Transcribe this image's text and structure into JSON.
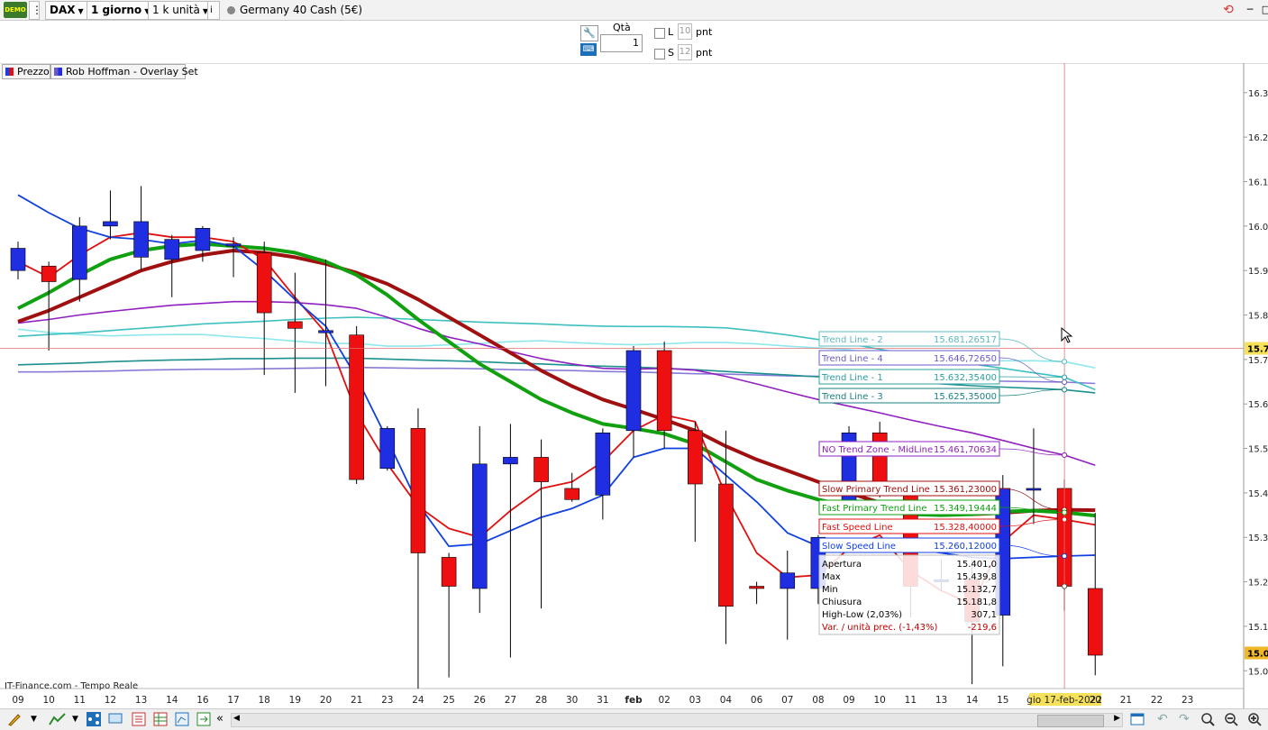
{
  "toolbar": {
    "logo": "DEMO",
    "instrument": "DAX",
    "timeframe": "1 giorno",
    "units": "1 k unità",
    "info_icon": "i",
    "market": "Germany 40 Cash (5€)"
  },
  "order": {
    "qty_label": "Qtà",
    "qty_value": "1",
    "long_label": "L",
    "long_points": "10",
    "short_label": "S",
    "short_points": "12",
    "points_unit": "pnt"
  },
  "legend_tabs": [
    "Prezzo",
    "Rob Hoffman - Overlay Set"
  ],
  "watermark": "IT-Finance.com - Tempo Reale",
  "chart_data": {
    "type": "candlestick",
    "price_axis": {
      "ymin": 14960,
      "ymax": 16330,
      "ticks": [
        15000,
        15100,
        15200,
        15300,
        15400,
        15500,
        15600,
        15700,
        15800,
        15900,
        16000,
        16100,
        16200,
        16300
      ],
      "tick_labels": [
        "15.0",
        "15.1",
        "15.2",
        "15.3",
        "15.4",
        "15.5",
        "15.6",
        "15.7",
        "15.8",
        "15.9",
        "16.0",
        "16.1",
        "16.2",
        "16.3"
      ],
      "current_label": "15.7",
      "current_price": 15725,
      "last_close_label": "15.0",
      "last_close_price": 15040
    },
    "date_labels": [
      "09",
      "10",
      "11",
      "12",
      "13",
      "14",
      "16",
      "17",
      "18",
      "19",
      "20",
      "21",
      "23",
      "24",
      "25",
      "26",
      "27",
      "28",
      "30",
      "31",
      "feb",
      "02",
      "03",
      "04",
      "06",
      "07",
      "08",
      "09",
      "10",
      "11",
      "13",
      "14",
      "15",
      "16",
      "gio 17-feb-2022",
      "20",
      "21",
      "22",
      "23"
    ],
    "highlighted_date": "gio 17-feb-2022",
    "candles": [
      {
        "o": 15900,
        "c": 15950,
        "h": 15965,
        "l": 15880
      },
      {
        "o": 15910,
        "c": 15875,
        "h": 15920,
        "l": 15720
      },
      {
        "o": 15880,
        "c": 16000,
        "h": 16020,
        "l": 15830
      },
      {
        "o": 16000,
        "c": 16010,
        "h": 16080,
        "l": 15970
      },
      {
        "o": 15930,
        "c": 16010,
        "h": 16090,
        "l": 15900
      },
      {
        "o": 15925,
        "c": 15970,
        "h": 15980,
        "l": 15840
      },
      {
        "o": 15945,
        "c": 15995,
        "h": 16000,
        "l": 15920
      },
      {
        "o": 15955,
        "c": 15960,
        "h": 15975,
        "l": 15885
      },
      {
        "o": 15940,
        "c": 15805,
        "h": 15965,
        "l": 15665
      },
      {
        "o": 15785,
        "c": 15770,
        "h": 15895,
        "l": 15625
      },
      {
        "o": 15760,
        "c": 15765,
        "h": 15925,
        "l": 15640
      },
      {
        "o": 15755,
        "c": 15430,
        "h": 15775,
        "l": 15420
      },
      {
        "o": 15455,
        "c": 15545,
        "h": 15550,
        "l": 15450
      },
      {
        "o": 15545,
        "c": 15265,
        "h": 15590,
        "l": 14960
      },
      {
        "o": 15255,
        "c": 15190,
        "h": 15265,
        "l": 14985
      },
      {
        "o": 15185,
        "c": 15465,
        "h": 15550,
        "l": 15130
      },
      {
        "o": 15465,
        "c": 15480,
        "h": 15555,
        "l": 15030
      },
      {
        "o": 15480,
        "c": 15425,
        "h": 15520,
        "l": 15140
      },
      {
        "o": 15410,
        "c": 15385,
        "h": 15445,
        "l": 15380
      },
      {
        "o": 15395,
        "c": 15535,
        "h": 15545,
        "l": 15340
      },
      {
        "o": 15540,
        "c": 15720,
        "h": 15730,
        "l": 15480
      },
      {
        "o": 15720,
        "c": 15540,
        "h": 15740,
        "l": 15500
      },
      {
        "o": 15540,
        "c": 15420,
        "h": 15560,
        "l": 15290
      },
      {
        "o": 15420,
        "c": 15145,
        "h": 15540,
        "l": 15060
      },
      {
        "o": 15190,
        "c": 15185,
        "h": 15200,
        "l": 15150
      },
      {
        "o": 15185,
        "c": 15220,
        "h": 15270,
        "l": 15070
      },
      {
        "o": 15185,
        "c": 15300,
        "h": 15305,
        "l": 15150
      },
      {
        "o": 15380,
        "c": 15535,
        "h": 15550,
        "l": 15370
      },
      {
        "o": 15535,
        "c": 15400,
        "h": 15560,
        "l": 15390
      },
      {
        "o": 15400,
        "c": 15190,
        "h": 15420,
        "l": 15120
      },
      {
        "o": 15200,
        "c": 15205,
        "h": 15250,
        "l": 15180
      },
      {
        "o": 15205,
        "c": 15110,
        "h": 15250,
        "l": 14970
      },
      {
        "o": 15125,
        "c": 15410,
        "h": 15440,
        "l": 15010
      },
      {
        "o": 15410,
        "c": 15410,
        "h": 15545,
        "l": 15330
      },
      {
        "o": 15410,
        "c": 15190,
        "h": 15430,
        "l": 15135
      },
      {
        "o": 15185,
        "c": 15035,
        "h": 15355,
        "l": 14990
      }
    ],
    "series": [
      {
        "name": "Trend Line - 2",
        "color": "#8fe8ee",
        "values": [
          15768,
          15761,
          15756,
          15753,
          15755,
          15756,
          15756,
          15751,
          15747,
          15741,
          15736,
          15736,
          15730,
          15730,
          15733,
          15736,
          15740,
          15742,
          15738,
          15735,
          15733,
          15735,
          15738,
          15738,
          15735,
          15730,
          15726,
          15722,
          15712,
          15707,
          15703,
          15698,
          15697,
          15697,
          15695,
          15681
        ]
      },
      {
        "name": "Trend Line - 4",
        "color": "#8a7ad8",
        "values": [
          15672,
          15672,
          15673,
          15674,
          15676,
          15677,
          15678,
          15678,
          15679,
          15680,
          15681,
          15682,
          15681,
          15680,
          15680,
          15679,
          15677,
          15676,
          15675,
          15673,
          15672,
          15670,
          15668,
          15667,
          15665,
          15663,
          15662,
          15660,
          15658,
          15656,
          15654,
          15652,
          15651,
          15650,
          15649,
          15646
        ]
      },
      {
        "name": "Trend Line - 1",
        "color": "#3ec0c0",
        "values": [
          15752,
          15756,
          15760,
          15765,
          15770,
          15775,
          15780,
          15783,
          15786,
          15790,
          15793,
          15795,
          15793,
          15790,
          15787,
          15784,
          15782,
          15780,
          15777,
          15775,
          15774,
          15774,
          15773,
          15771,
          15764,
          15755,
          15745,
          15735,
          15723,
          15711,
          15700,
          15690,
          15680,
          15670,
          15660,
          15632
        ]
      },
      {
        "name": "Trend Line - 3",
        "color": "#1e9090",
        "values": [
          15688,
          15690,
          15692,
          15695,
          15697,
          15699,
          15700,
          15702,
          15702,
          15703,
          15703,
          15703,
          15701,
          15699,
          15697,
          15695,
          15692,
          15690,
          15687,
          15685,
          15683,
          15680,
          15677,
          15673,
          15669,
          15665,
          15661,
          15657,
          15653,
          15649,
          15645,
          15641,
          15638,
          15635,
          15632,
          15625
        ]
      },
      {
        "name": "NO Trend Zone - MidLine",
        "color": "#9020c0",
        "values": [
          15782,
          15790,
          15800,
          15808,
          15815,
          15822,
          15826,
          15830,
          15830,
          15828,
          15823,
          15815,
          15795,
          15770,
          15750,
          15735,
          15718,
          15702,
          15690,
          15680,
          15678,
          15680,
          15676,
          15662,
          15645,
          15627,
          15610,
          15595,
          15580,
          15564,
          15549,
          15535,
          15518,
          15500,
          15485,
          15462
        ]
      },
      {
        "name": "Slow Primary Trend Line",
        "color": "#a01010",
        "values": [
          15785,
          15810,
          15840,
          15870,
          15900,
          15920,
          15935,
          15945,
          15940,
          15930,
          15915,
          15895,
          15870,
          15835,
          15795,
          15755,
          15715,
          15675,
          15640,
          15610,
          15588,
          15565,
          15540,
          15505,
          15475,
          15450,
          15425,
          15400,
          15378,
          15365,
          15355,
          15352,
          15355,
          15360,
          15362,
          15361
        ]
      },
      {
        "name": "Fast Primary Trend Line",
        "color": "#10a010",
        "values": [
          15815,
          15850,
          15890,
          15925,
          15945,
          15955,
          15960,
          15955,
          15950,
          15940,
          15920,
          15890,
          15845,
          15790,
          15740,
          15690,
          15650,
          15610,
          15580,
          15555,
          15545,
          15533,
          15510,
          15470,
          15430,
          15405,
          15385,
          15370,
          15360,
          15352,
          15350,
          15352,
          15358,
          15360,
          15356,
          15349
        ]
      },
      {
        "name": "Fast Speed Line",
        "color": "#e01010",
        "values": [
          15920,
          15885,
          15935,
          15975,
          15985,
          15975,
          15975,
          15965,
          15925,
          15840,
          15760,
          15580,
          15465,
          15370,
          15320,
          15300,
          15360,
          15410,
          15425,
          15470,
          15540,
          15575,
          15560,
          15395,
          15265,
          15210,
          15215,
          15275,
          15305,
          15225,
          15180,
          15150,
          15290,
          15350,
          15340,
          15328
        ]
      },
      {
        "name": "Slow Speed Line",
        "color": "#1040e0",
        "values": [
          16070,
          16030,
          15995,
          15975,
          15970,
          15960,
          15968,
          15955,
          15900,
          15835,
          15775,
          15660,
          15520,
          15375,
          15280,
          15285,
          15315,
          15345,
          15365,
          15395,
          15480,
          15500,
          15500,
          15440,
          15380,
          15310,
          15280,
          15280,
          15285,
          15275,
          15265,
          15255,
          15252,
          15255,
          15258,
          15260
        ]
      }
    ],
    "line_labels": [
      {
        "label": "Trend Line - 2",
        "value": "15.681,26517",
        "color": "#5ab8c0"
      },
      {
        "label": "Trend Line - 4",
        "value": "15.646,72650",
        "color": "#6a5ac8"
      },
      {
        "label": "Trend Line - 1",
        "value": "15.632,35400",
        "color": "#2aa0a0"
      },
      {
        "label": "Trend Line - 3",
        "value": "15.625,35000",
        "color": "#1a8080"
      },
      {
        "label": "NO Trend Zone - MidLine",
        "value": "15.461,70634",
        "color": "#9020c0"
      },
      {
        "label": "Slow Primary Trend Line",
        "value": "15.361,23000",
        "color": "#a01010"
      },
      {
        "label": "Fast Primary Trend Line",
        "value": "15.349,19444",
        "color": "#10a010"
      },
      {
        "label": "Fast Speed Line",
        "value": "15.328,40000",
        "color": "#e01010"
      },
      {
        "label": "Slow Speed Line",
        "value": "15.260,12000",
        "color": "#1040e0"
      }
    ],
    "ohlc_info": [
      {
        "label": "Apertura",
        "value": "15.401,0"
      },
      {
        "label": "Max",
        "value": "15.439,8"
      },
      {
        "label": "Min",
        "value": "15.132,7"
      },
      {
        "label": "Chiusura",
        "value": "15.181,8"
      },
      {
        "label": "High-Low (2,03%)",
        "value": "307,1"
      },
      {
        "label": "Var. / unità prec. (-1,43%)",
        "value": "-219,6",
        "color": "#c00000"
      }
    ],
    "colors": {
      "up": "#1e2ee0",
      "down": "#ee1010",
      "crosshair": "#e07070",
      "highlight": "#f5e15a"
    }
  }
}
